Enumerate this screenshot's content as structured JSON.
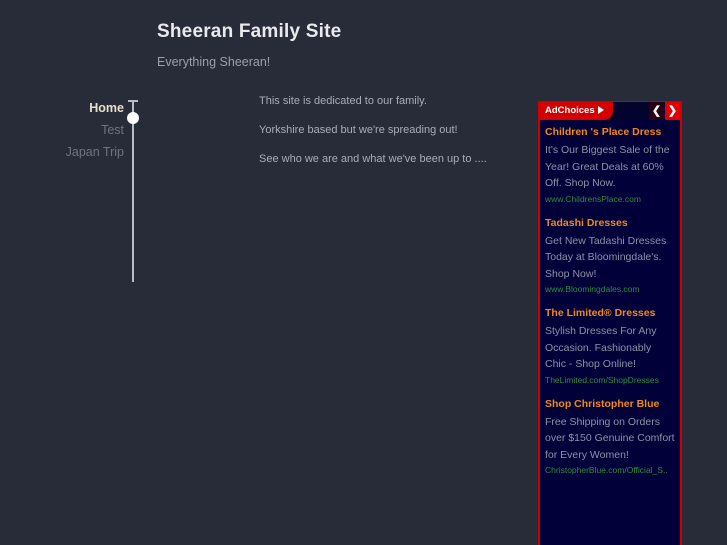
{
  "header": {
    "title": "Sheeran Family Site",
    "subtitle": "Everything Sheeran!"
  },
  "sidebar": {
    "items": [
      {
        "label": "Home",
        "active": true
      },
      {
        "label": "Test",
        "active": false
      },
      {
        "label": "Japan Trip",
        "active": false
      }
    ]
  },
  "main": {
    "paragraphs": [
      "This site is dedicated to our family.",
      "Yorkshire based but we're spreading out!",
      "See who we are and what we've been up to ...."
    ]
  },
  "ads": {
    "choices_label": "AdChoices",
    "choices_icon": "play-triangle-icon",
    "prev_label": "❮",
    "next_label": "❯",
    "accent_color": "#d40000",
    "title_color": "#f08a1a",
    "url_color": "#2f8f3f",
    "background_color": "#010038",
    "items": [
      {
        "title": "Children 's Place Dress",
        "body": "It's Our Biggest Sale of the Year! Great Deals at 60% Off. Shop Now.",
        "url": "www.ChildrensPlace.com"
      },
      {
        "title": "Tadashi Dresses",
        "body": "Get New Tadashi Dresses Today at Bloomingdale's. Shop Now!",
        "url": "www.Bloomingdales.com"
      },
      {
        "title": "The Limited® Dresses",
        "body": "Stylish Dresses For Any Occasion. Fashionably Chic - Shop Online!",
        "url": "TheLimited.com/ShopDresses"
      },
      {
        "title": "Shop Christopher Blue",
        "body": "Free Shipping on Orders over $150 Genuine Comfort for Every Women!",
        "url": "ChristopherBlue.com/Official_S.."
      }
    ]
  }
}
